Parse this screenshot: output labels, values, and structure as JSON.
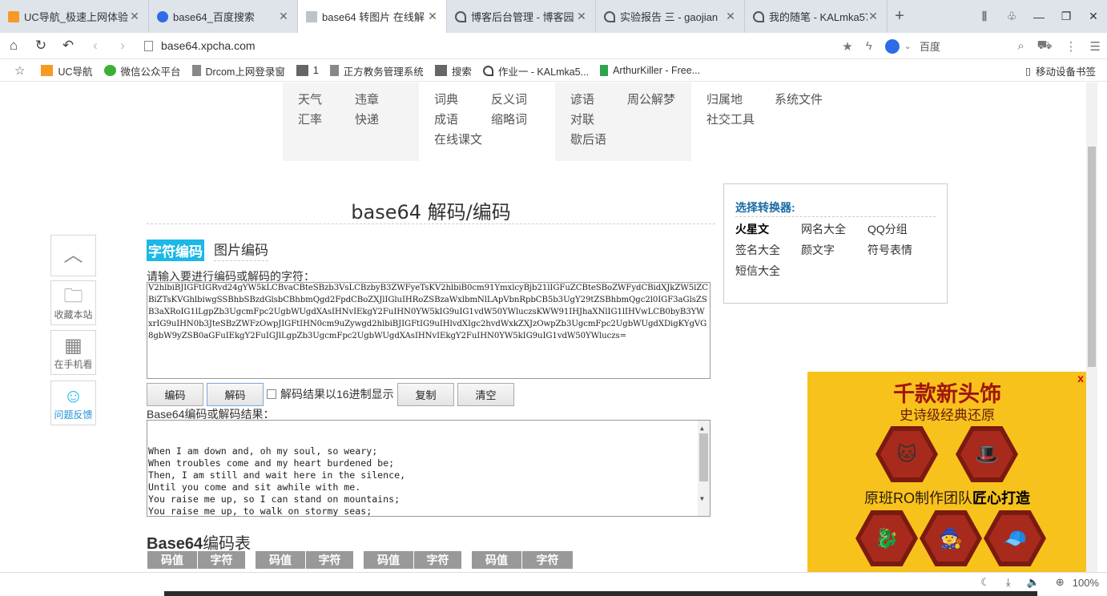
{
  "tabs": [
    {
      "label": "UC导航_极速上网体验",
      "icon": "uc-icon"
    },
    {
      "label": "base64_百度搜索",
      "icon": "baidu-icon"
    },
    {
      "label": "base64 转图片 在线解",
      "icon": "page-icon"
    },
    {
      "label": "博客后台管理 - 博客园",
      "icon": "blog-icon"
    },
    {
      "label": "实验报告 三 - gaojian",
      "icon": "blog-icon"
    },
    {
      "label": "我的随笔 - KALmka57",
      "icon": "blog-icon"
    }
  ],
  "address": {
    "url": "base64.xpcha.com",
    "search_engine_text": "百度"
  },
  "bookmarks": [
    {
      "label": "UC导航",
      "icon": "uc-icon"
    },
    {
      "label": "微信公众平台",
      "icon": "wechat-icon"
    },
    {
      "label": "Drcom上网登录窗",
      "icon": "page-icon"
    },
    {
      "label": "1",
      "icon": "folder-icon"
    },
    {
      "label": "正方教务管理系统",
      "icon": "page-icon"
    },
    {
      "label": "搜索",
      "icon": "folder-icon"
    },
    {
      "label": "作业一 - KALmka5...",
      "icon": "blog-icon"
    },
    {
      "label": "ArthurKiller - Free...",
      "icon": "green-icon"
    }
  ],
  "bookmarks_right": "移动设备书签",
  "nav_links": {
    "col1": [
      "天气",
      "汇率"
    ],
    "col2": [
      "违章",
      "快递"
    ],
    "col3": [
      "词典",
      "成语",
      "在线课文"
    ],
    "col4": [
      "反义词",
      "缩略词"
    ],
    "col5": [
      "谚语",
      "对联",
      "歇后语"
    ],
    "col6": [
      "周公解梦"
    ],
    "col7": [
      "归属地",
      "社交工具"
    ],
    "col8": [
      "系统文件"
    ]
  },
  "page": {
    "title": "base64 解码/编码",
    "tab_text": "字符编码",
    "tab_image": "图片编码",
    "input_label": "请输入要进行编码或解码的字符：",
    "input_value": "V2hlbiBJIGFtIGRvd24gYW5kLCBvaCBteSBzb3VsLCBzbyB3ZWFyeTsKV2hlbiB0cm91YmxlcyBjb21lIGFuZCBteSBoZWFydCBidXJkZW5lZCBiZTsKVGhlbiwgSSBhbSBzdGlsbCBhbmQgd2FpdCBoZXJlIGluIHRoZSBzaWxlbmNlLApVbnRpbCB5b3UgY29tZSBhbmQgc2l0IGF3aGlsZSB3aXRoIG1lLgpZb3UgcmFpc2UgbWUgdXAsIHNvIEkgY2FuIHN0YW5kIG9uIG1vdW50YWluczsKWW91IHJhaXNlIG1lIHVwLCB0byB3YWxrIG9uIHN0b3JteSBzZWFzOwpJIGFtIHN0cm9uZywgd2hlbiBJIGFtIG9uIHlvdXIgc2hvdWxkZXJzOwpZb3UgcmFpc2UgbWUgdXDigKYgVG8gbW9yZSB0aGFuIEkgY2FuIGJlLgpZb3UgcmFpc2UgbWUgdXAsIHNvIEkgY2FuIHN0YW5kIG9uIG1vdW50YWluczs=",
    "btn_encode": "编码",
    "btn_decode": "解码",
    "hex_checkbox_label": "解码结果以16进制显示",
    "btn_copy": "复制",
    "btn_clear": "清空",
    "result_label": "Base64编码或解码结果：",
    "result_value": "When I am down and, oh my soul, so weary;\nWhen troubles come and my heart burdened be;\nThen, I am still and wait here in the silence,\nUntil you come and sit awhile with me.\nYou raise me up, so I can stand on mountains;\nYou raise me up, to walk on stormy seas;\nI am strong, when I am on your shoulders;\nYou raise me up… To more than I can be.",
    "table_title_bold": "Base64",
    "table_title_rest": "编码表",
    "table_headers": [
      "码值",
      "字符",
      "码值",
      "字符",
      "码值",
      "字符",
      "码值",
      "字符"
    ]
  },
  "side_tools": {
    "favorite": "收藏本站",
    "mobile": "在手机看",
    "feedback": "问题反馈"
  },
  "converter": {
    "title": "选择转换器:",
    "items": [
      "火星文",
      "网名大全",
      "QQ分组",
      "签名大全",
      "颜文字",
      "符号表情",
      "短信大全"
    ]
  },
  "ad": {
    "close": "x",
    "headline": "千款新头饰",
    "subline": "史诗级经典还原",
    "tagline_prefix": "原班RO制作团队",
    "tagline_bold": "匠心打造"
  },
  "status": {
    "zoom": "100%"
  }
}
